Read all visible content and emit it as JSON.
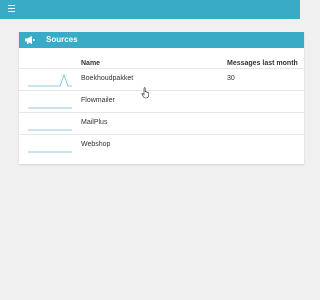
{
  "panel": {
    "title": "Sources",
    "icon": "megaphone-icon"
  },
  "table": {
    "columns": [
      "Name",
      "Messages last month"
    ],
    "rows": [
      {
        "name": "Boekhoudpakket",
        "messages": "30",
        "sparkline": [
          0,
          0,
          0,
          0,
          0,
          0,
          0,
          0,
          0,
          1,
          0,
          0
        ]
      },
      {
        "name": "Flowmailer",
        "messages": "",
        "sparkline": [
          0,
          0,
          0,
          0,
          0,
          0,
          0,
          0,
          0,
          0,
          0,
          0
        ]
      },
      {
        "name": "MailPlus",
        "messages": "",
        "sparkline": [
          0,
          0,
          0,
          0,
          0,
          0,
          0,
          0,
          0,
          0,
          0,
          0
        ]
      },
      {
        "name": "Webshop",
        "messages": "",
        "sparkline": [
          0,
          0,
          0,
          0,
          0,
          0,
          0,
          0,
          0,
          0,
          0,
          0
        ]
      }
    ]
  },
  "colors": {
    "accent": "#3aabc6",
    "sparkline": "#6fb8d8"
  }
}
